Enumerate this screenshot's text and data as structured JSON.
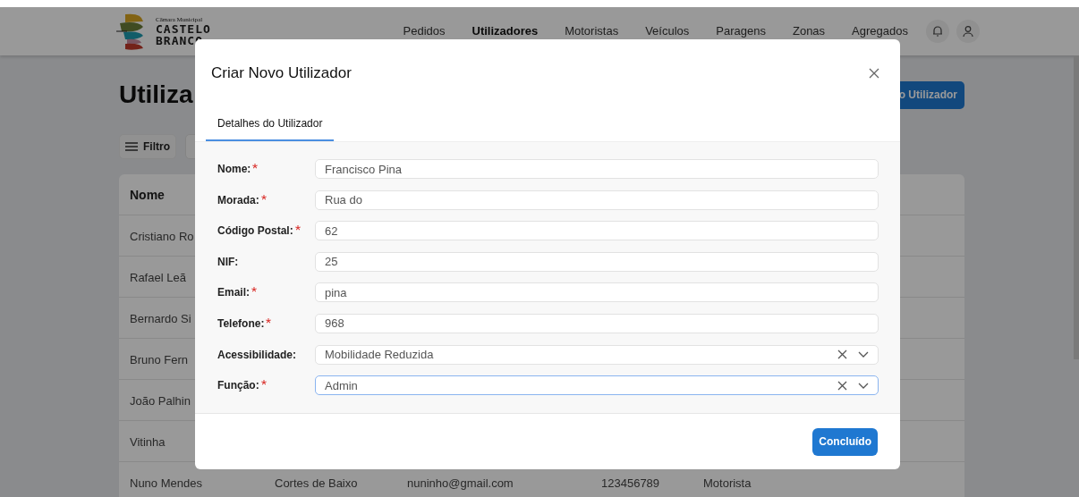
{
  "header": {
    "logo": {
      "caption": "Câmara Municipal",
      "lines": [
        "CASTELO",
        "BRANCO"
      ]
    },
    "nav": [
      {
        "label": "Pedidos",
        "selected": false
      },
      {
        "label": "Utilizadores",
        "selected": true
      },
      {
        "label": "Motoristas",
        "selected": false
      },
      {
        "label": "Veículos",
        "selected": false
      },
      {
        "label": "Paragens",
        "selected": false
      },
      {
        "label": "Zonas",
        "selected": false
      },
      {
        "label": "Agregados",
        "selected": false
      }
    ]
  },
  "page": {
    "title": "Utiliza",
    "new_button": "o Utilizador",
    "filter_button": "Filtro",
    "table": {
      "columns": [
        "Nome"
      ],
      "rows": [
        [
          "Cristiano Ro"
        ],
        [
          "Rafael Leã"
        ],
        [
          "Bernardo Si"
        ],
        [
          "Bruno Fern"
        ],
        [
          "João Palhin"
        ],
        [
          "Vitinha"
        ],
        [
          "Nuno Mendes",
          "Cortes de Baixo",
          "nuninho@gmail.com",
          "123456789",
          "Motorista"
        ]
      ]
    }
  },
  "dialog": {
    "title": "Criar Novo Utilizador",
    "tabs": [
      {
        "label": "Detalhes do Utilizador",
        "selected": true
      }
    ],
    "fields": [
      {
        "kind": "text",
        "label": "Nome:",
        "required": true,
        "value": "Francisco Pina",
        "focused": false
      },
      {
        "kind": "text",
        "label": "Morada:",
        "required": true,
        "value": "Rua do",
        "focused": false
      },
      {
        "kind": "text",
        "label": "Código Postal:",
        "required": true,
        "value": "62",
        "focused": false
      },
      {
        "kind": "text",
        "label": "NIF:",
        "required": false,
        "value": "25",
        "focused": false
      },
      {
        "kind": "text",
        "label": "Email:",
        "required": true,
        "value": "pina",
        "focused": false
      },
      {
        "kind": "text",
        "label": "Telefone:",
        "required": true,
        "value": "968",
        "focused": false
      },
      {
        "kind": "select",
        "label": "Acessibilidade:",
        "required": false,
        "value": "Mobilidade Reduzida",
        "focused": false
      },
      {
        "kind": "select",
        "label": "Função:",
        "required": true,
        "value": "Admin",
        "focused": true
      }
    ],
    "submit": "Concluído"
  }
}
